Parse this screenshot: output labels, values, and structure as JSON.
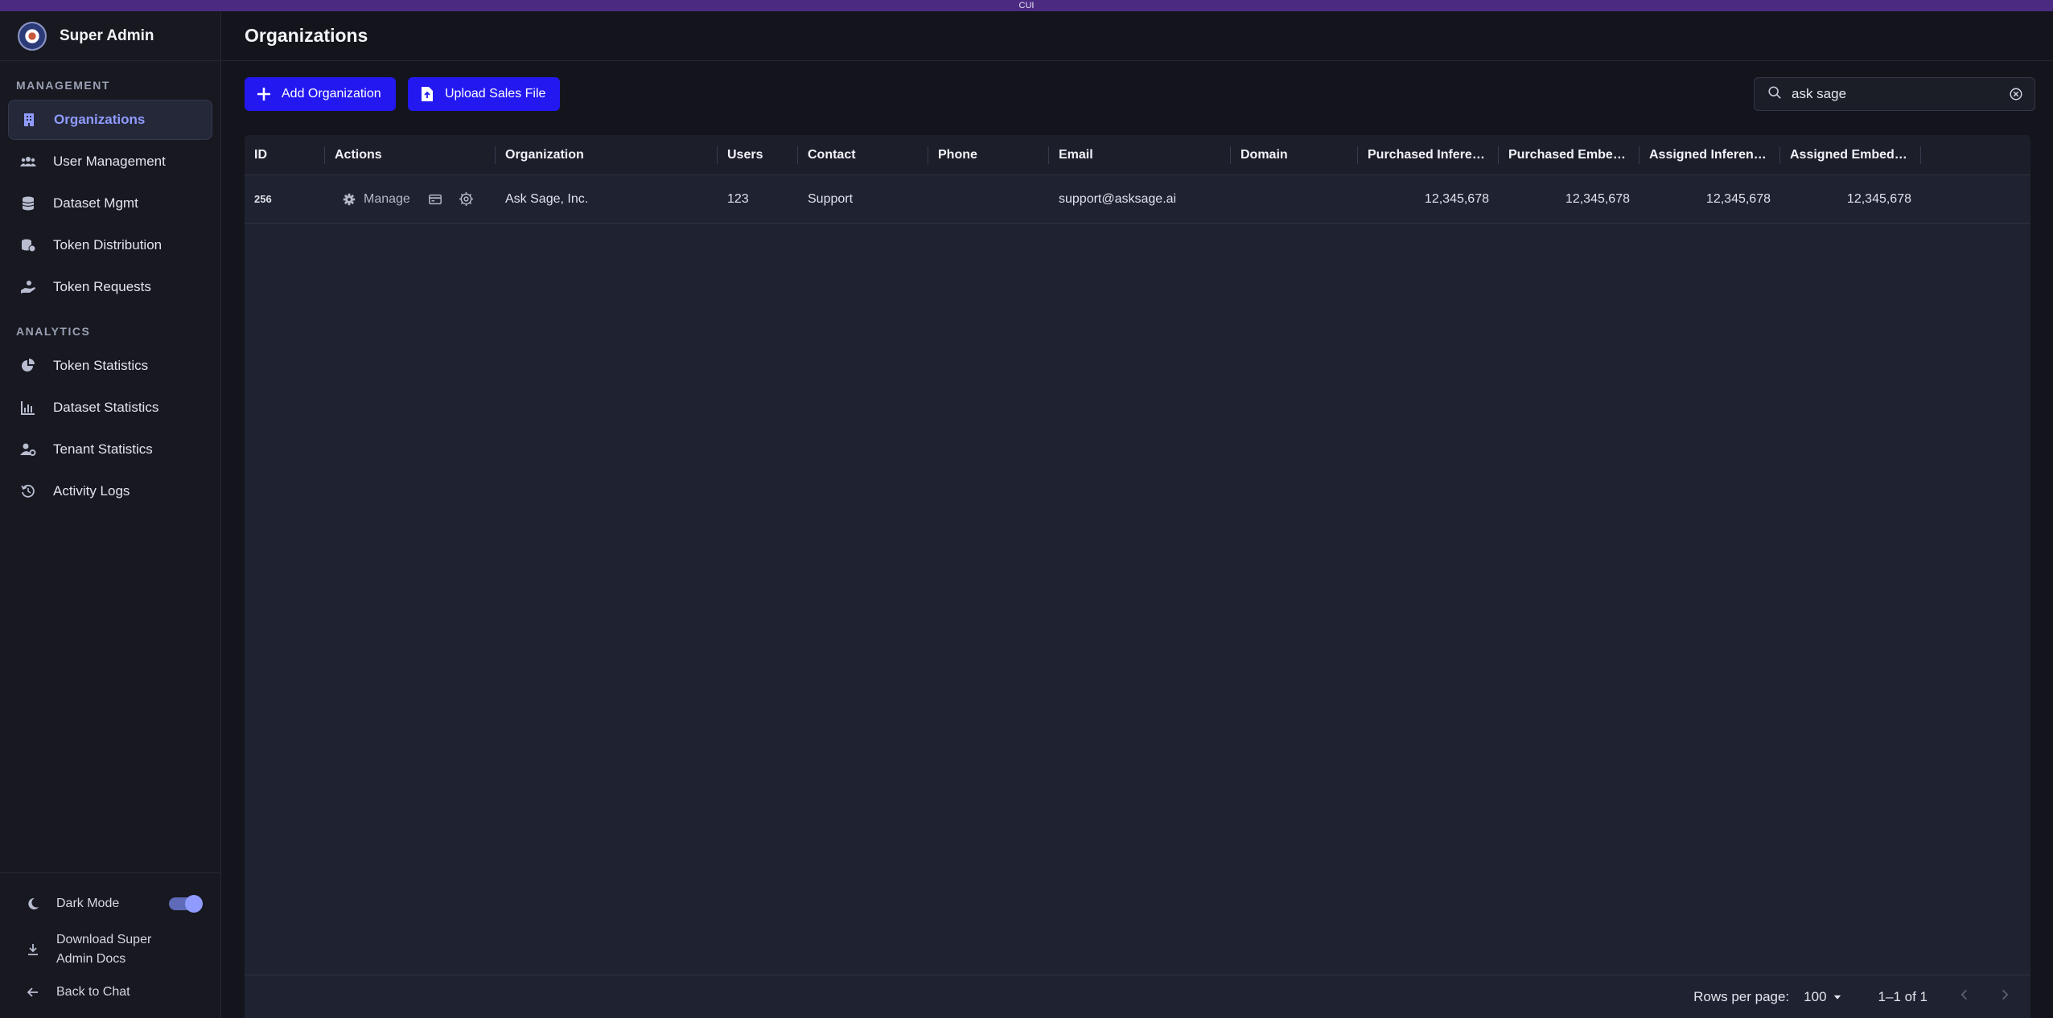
{
  "banner": "CUI",
  "sidebar": {
    "title": "Super Admin",
    "sections": [
      {
        "label": "MANAGEMENT"
      },
      {
        "label": "ANALYTICS"
      }
    ],
    "management_items": [
      {
        "label": "Organizations",
        "icon": "building-icon",
        "active": true
      },
      {
        "label": "User Management",
        "icon": "users-icon"
      },
      {
        "label": "Dataset Mgmt",
        "icon": "database-icon"
      },
      {
        "label": "Token Distribution",
        "icon": "coins-icon"
      },
      {
        "label": "Token Requests",
        "icon": "hand-coin-icon"
      }
    ],
    "analytics_items": [
      {
        "label": "Token Statistics",
        "icon": "pie-chart-icon"
      },
      {
        "label": "Dataset Statistics",
        "icon": "bar-chart-icon"
      },
      {
        "label": "Tenant Statistics",
        "icon": "user-gear-icon"
      },
      {
        "label": "Activity Logs",
        "icon": "history-icon"
      }
    ],
    "bottom": {
      "dark_mode_label": "Dark Mode",
      "dark_mode_on": true,
      "docs_line1": "Download Super",
      "docs_line2": "Admin Docs",
      "back_label": "Back to Chat"
    }
  },
  "main": {
    "title": "Organizations",
    "add_button": "Add Organization",
    "upload_button": "Upload Sales File",
    "search_value": "ask sage"
  },
  "table": {
    "columns": [
      "ID",
      "Actions",
      "Organization",
      "Users",
      "Contact",
      "Phone",
      "Email",
      "Domain",
      "Purchased Infere…",
      "Purchased Embe…",
      "Assigned Inferen…",
      "Assigned Embed…"
    ],
    "rows": [
      {
        "id": "256",
        "manage_label": "Manage",
        "organization": "Ask Sage, Inc.",
        "users": "123",
        "contact": "Support",
        "phone": "",
        "email": "support@asksage.ai",
        "domain": "",
        "purchased_inference": "12,345,678",
        "purchased_embedding": "12,345,678",
        "assigned_inference": "12,345,678",
        "assigned_embedding": "12,345,678"
      }
    ],
    "footer": {
      "rows_per_page_label": "Rows per page:",
      "rows_per_page_value": "100",
      "range": "1–1 of 1"
    }
  },
  "colors": {
    "accent": "#2318f0",
    "active_nav_text": "#8f9bff",
    "banner": "#4b2b82"
  }
}
